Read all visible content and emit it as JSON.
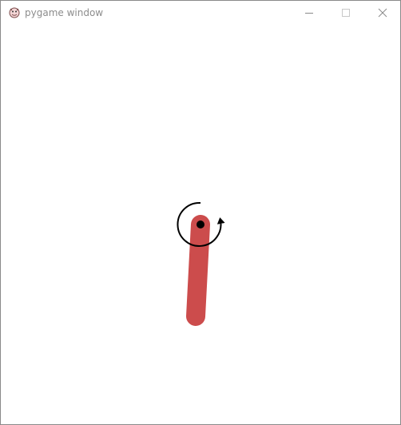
{
  "window": {
    "title": "pygame window",
    "app_icon": "pygame-snake-icon",
    "controls": [
      "minimize-icon",
      "maximize-icon",
      "close-icon"
    ]
  },
  "scene": {
    "background": "#ffffff",
    "pole_color": "#cc4c4c",
    "pivot_color": "#000000",
    "arrow_color": "#000000",
    "arrow_icon": "counterclockwise-rotation-arrow-icon"
  }
}
